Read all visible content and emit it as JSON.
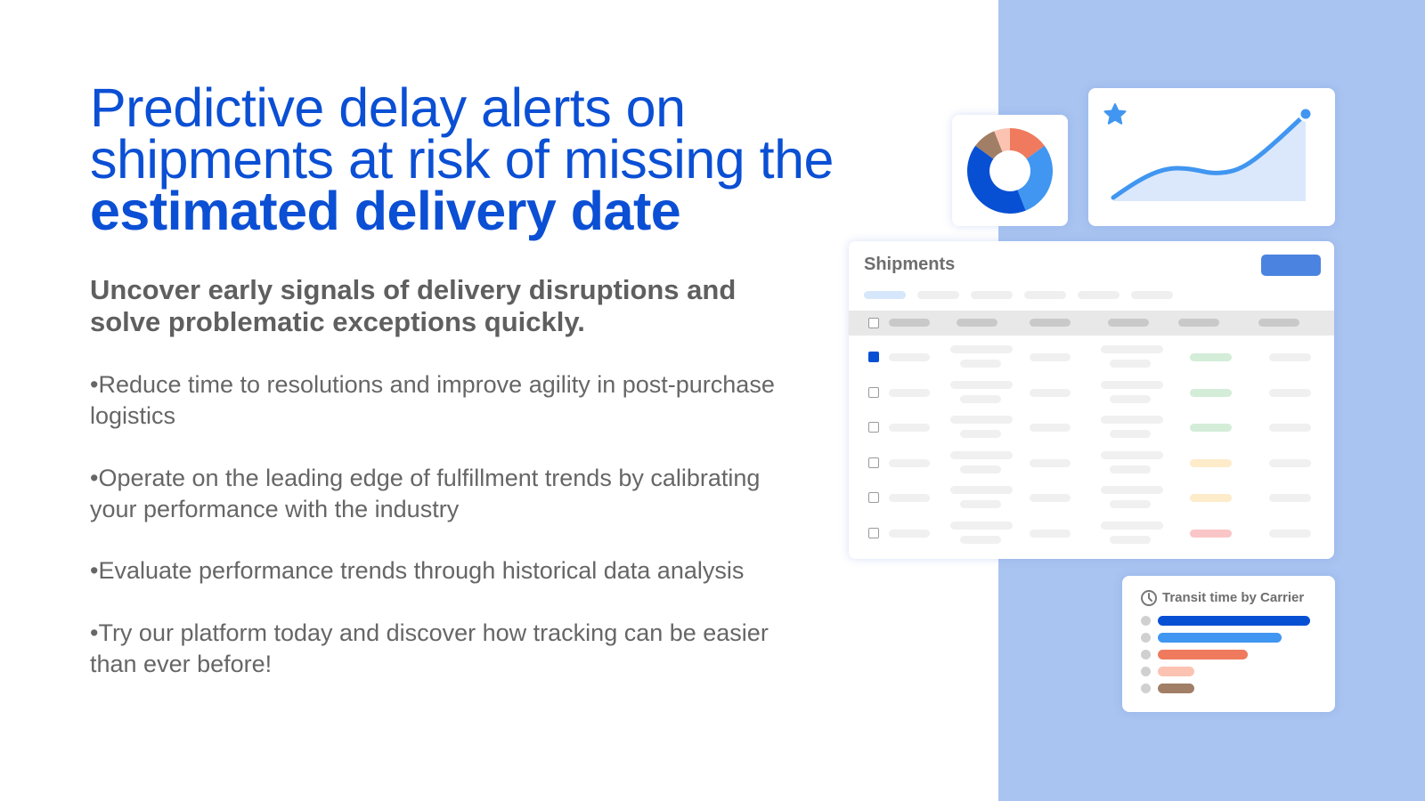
{
  "headline": {
    "line_plain": "Predictive delay alerts on shipments at risk of missing the ",
    "line_bold": "estimated delivery date"
  },
  "subheading": "Uncover early signals of delivery disruptions and solve problematic exceptions quickly.",
  "bullets": [
    "•Reduce time to resolutions and improve agility in post-purchase logistics",
    "•Operate on the leading edge of fulfillment trends by calibrating your performance with the industry",
    "•Evaluate performance trends through historical data analysis",
    "•Try our platform today and discover how tracking can be easier than ever before!"
  ],
  "colors": {
    "accent": "#0b4fd4",
    "panel": "#a9c4f0",
    "light_blue": "#4096f0",
    "orange": "#ef7a5e",
    "pink": "#fcc3b2",
    "brown": "#a17e66"
  },
  "donut": {
    "slices": [
      {
        "value": 15,
        "color": "#ef7a5e"
      },
      {
        "value": 29,
        "color": "#4096f0"
      },
      {
        "value": 41,
        "color": "#0750d4"
      },
      {
        "value": 9,
        "color": "#a17e66"
      },
      {
        "value": 6,
        "color": "#fcc3b2"
      }
    ]
  },
  "line_card": {
    "icon": "star-icon"
  },
  "shipments": {
    "title": "Shipments",
    "rows": [
      {
        "checked": true,
        "status": "#d3edd8"
      },
      {
        "checked": false,
        "status": "#d3edd8"
      },
      {
        "checked": false,
        "status": "#d3edd8"
      },
      {
        "checked": false,
        "status": "#fdebc9"
      },
      {
        "checked": false,
        "status": "#fdebc9"
      },
      {
        "checked": false,
        "status": "#f9c5c6"
      }
    ]
  },
  "transit": {
    "title": "Transit time by Carrier",
    "icon": "clock-icon",
    "bars": [
      {
        "value": 100,
        "color": "#0750d4"
      },
      {
        "value": 81,
        "color": "#4096f0"
      },
      {
        "value": 59,
        "color": "#ef7a5e"
      },
      {
        "value": 24,
        "color": "#fcc3b2"
      },
      {
        "value": 24,
        "color": "#a17e66"
      }
    ]
  }
}
